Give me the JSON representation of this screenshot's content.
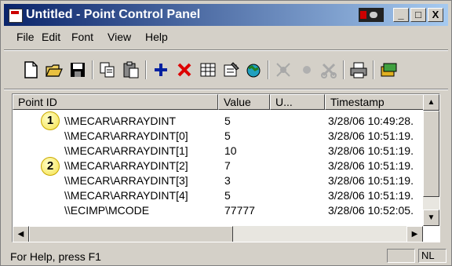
{
  "window": {
    "title": "Untitled - Point Control Panel",
    "controls": {
      "minimize": "_",
      "maximize": "□",
      "close": "X"
    }
  },
  "menu": [
    "File",
    "Edit",
    "Font",
    "View",
    "Help"
  ],
  "toolbar": {
    "icons": [
      "new-icon",
      "open-icon",
      "save-icon",
      "copy-icon",
      "paste-icon",
      "add-point-icon",
      "delete-point-icon",
      "grid-icon",
      "properties-icon",
      "connect-icon",
      "disabled-icon-1",
      "disabled-icon-2",
      "disabled-icon-3",
      "print-icon",
      "help-icon"
    ]
  },
  "list": {
    "columns": [
      "Point ID",
      "Value",
      "U...",
      "Timestamp"
    ],
    "rows": [
      {
        "point_id": "\\\\MECAR\\ARRAYDINT",
        "value": "5",
        "units": "",
        "timestamp": "3/28/06  10:49:28."
      },
      {
        "point_id": "\\\\MECAR\\ARRAYDINT[0]",
        "value": "5",
        "units": "",
        "timestamp": "3/28/06  10:51:19."
      },
      {
        "point_id": "\\\\MECAR\\ARRAYDINT[1]",
        "value": "10",
        "units": "",
        "timestamp": "3/28/06  10:51:19."
      },
      {
        "point_id": "\\\\MECAR\\ARRAYDINT[2]",
        "value": "7",
        "units": "",
        "timestamp": "3/28/06  10:51:19."
      },
      {
        "point_id": "\\\\MECAR\\ARRAYDINT[3]",
        "value": "3",
        "units": "",
        "timestamp": "3/28/06  10:51:19."
      },
      {
        "point_id": "\\\\MECAR\\ARRAYDINT[4]",
        "value": "5",
        "units": "",
        "timestamp": "3/28/06  10:51:19."
      },
      {
        "point_id": "\\\\ECIMP\\MCODE",
        "value": "77777",
        "units": "",
        "timestamp": "3/28/06  10:52:05."
      }
    ]
  },
  "callouts": [
    "1",
    "2"
  ],
  "status": {
    "help_text": "For Help, press F1",
    "panel_2": "NL"
  }
}
